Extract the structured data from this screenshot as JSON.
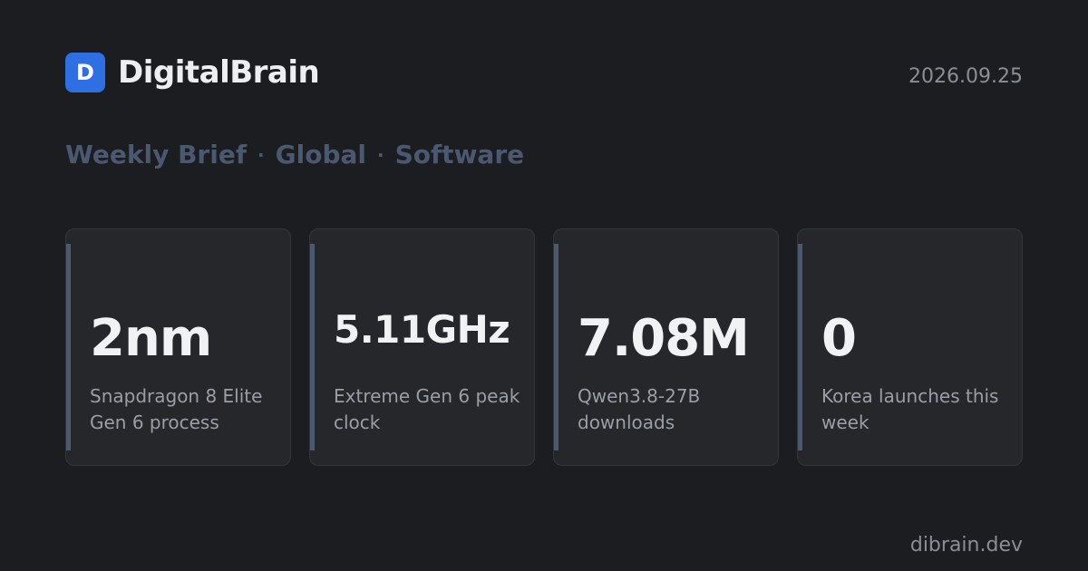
{
  "header": {
    "logo_letter": "D",
    "brand_name": "DigitalBrain",
    "date": "2026.09.25"
  },
  "subtitle": {
    "parts": [
      "Weekly Brief",
      "Global",
      "Software"
    ],
    "separator": "·"
  },
  "cards": [
    {
      "value": "2nm",
      "label": "Snapdragon 8 Elite Gen 6 process"
    },
    {
      "value": "5.11GHz",
      "label": "Extreme Gen 6 peak clock"
    },
    {
      "value": "7.08M",
      "label": "Qwen3.8-27B downloads"
    },
    {
      "value": "0",
      "label": "Korea launches this week"
    }
  ],
  "footer": {
    "domain": "dibrain.dev"
  },
  "colors": {
    "background": "#1c1d20",
    "logo_bg": "#2f6fe4",
    "subtitle": "#4a5870",
    "card_accent": "#4a5870"
  }
}
